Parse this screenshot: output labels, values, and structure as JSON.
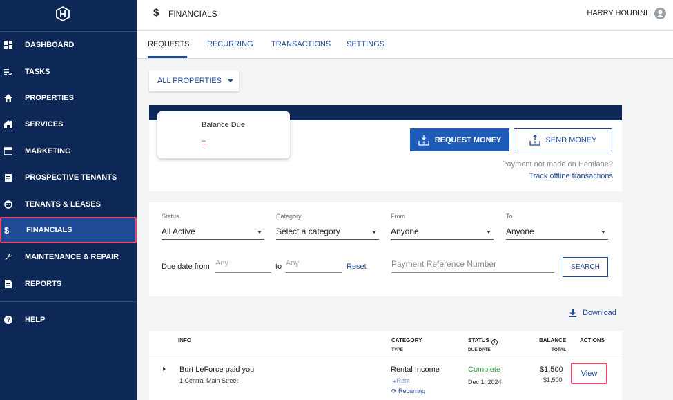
{
  "app": {
    "section_title": "FINANCIALS",
    "user_name": "HARRY HOUDINI"
  },
  "sidebar": {
    "items": [
      {
        "label": "DASHBOARD",
        "icon": "dashboard-icon"
      },
      {
        "label": "TASKS",
        "icon": "tasks-icon"
      },
      {
        "label": "PROPERTIES",
        "icon": "home-icon"
      },
      {
        "label": "SERVICES",
        "icon": "services-icon"
      },
      {
        "label": "MARKETING",
        "icon": "marketing-icon"
      },
      {
        "label": "PROSPECTIVE TENANTS",
        "icon": "clipboard-icon"
      },
      {
        "label": "TENANTS & LEASES",
        "icon": "tenant-face-icon"
      },
      {
        "label": "FINANCIALS",
        "icon": "dollar-icon",
        "active": true
      },
      {
        "label": "MAINTENANCE & REPAIR",
        "icon": "wrench-icon"
      },
      {
        "label": "REPORTS",
        "icon": "report-icon"
      },
      {
        "label": "HELP",
        "icon": "help-icon"
      }
    ]
  },
  "tabs": [
    {
      "label": "REQUESTS",
      "active": true
    },
    {
      "label": "RECURRING"
    },
    {
      "label": "TRANSACTIONS"
    },
    {
      "label": "SETTINGS"
    }
  ],
  "property_filter": {
    "label": "ALL PROPERTIES"
  },
  "balance": {
    "label": "Balance Due",
    "value": "–",
    "request_button": "REQUEST MONEY",
    "send_button": "SEND MONEY",
    "note": "Payment not made on Hemlane?",
    "track_link": "Track offline transactions"
  },
  "filters": {
    "status": {
      "label": "Status",
      "value": "All Active"
    },
    "category": {
      "label": "Category",
      "value": "Select a category"
    },
    "from": {
      "label": "From",
      "value": "Anyone"
    },
    "to": {
      "label": "To",
      "value": "Anyone"
    },
    "due_date_from_label": "Due date from",
    "due_from_placeholder": "Any",
    "to_label": "to",
    "due_to_placeholder": "Any",
    "reset_label": "Reset",
    "reference_placeholder": "Payment Reference Number",
    "search_button": "SEARCH"
  },
  "download_label": "Download",
  "table": {
    "headers": {
      "info": "INFO",
      "category": "CATEGORY",
      "category_sub": "TYPE",
      "status": "STATUS",
      "status_sub": "DUE DATE",
      "balance": "BALANCE",
      "balance_sub": "TOTAL",
      "actions": "ACTIONS"
    },
    "rows": [
      {
        "title": "Burt LeForce paid you",
        "address": "1 Central Main Street",
        "category": "Rental Income",
        "type": "↳Rent",
        "recurring": "Recurring",
        "status": "Complete",
        "due_date": "Dec 1, 2024",
        "balance": "$1,500",
        "total": "$1,500",
        "action": "View"
      }
    ]
  },
  "colors": {
    "sidebar_bg": "#0d2857",
    "accent": "#1f4a98",
    "highlight": "#e8476a",
    "status_complete": "#3aa04a"
  }
}
